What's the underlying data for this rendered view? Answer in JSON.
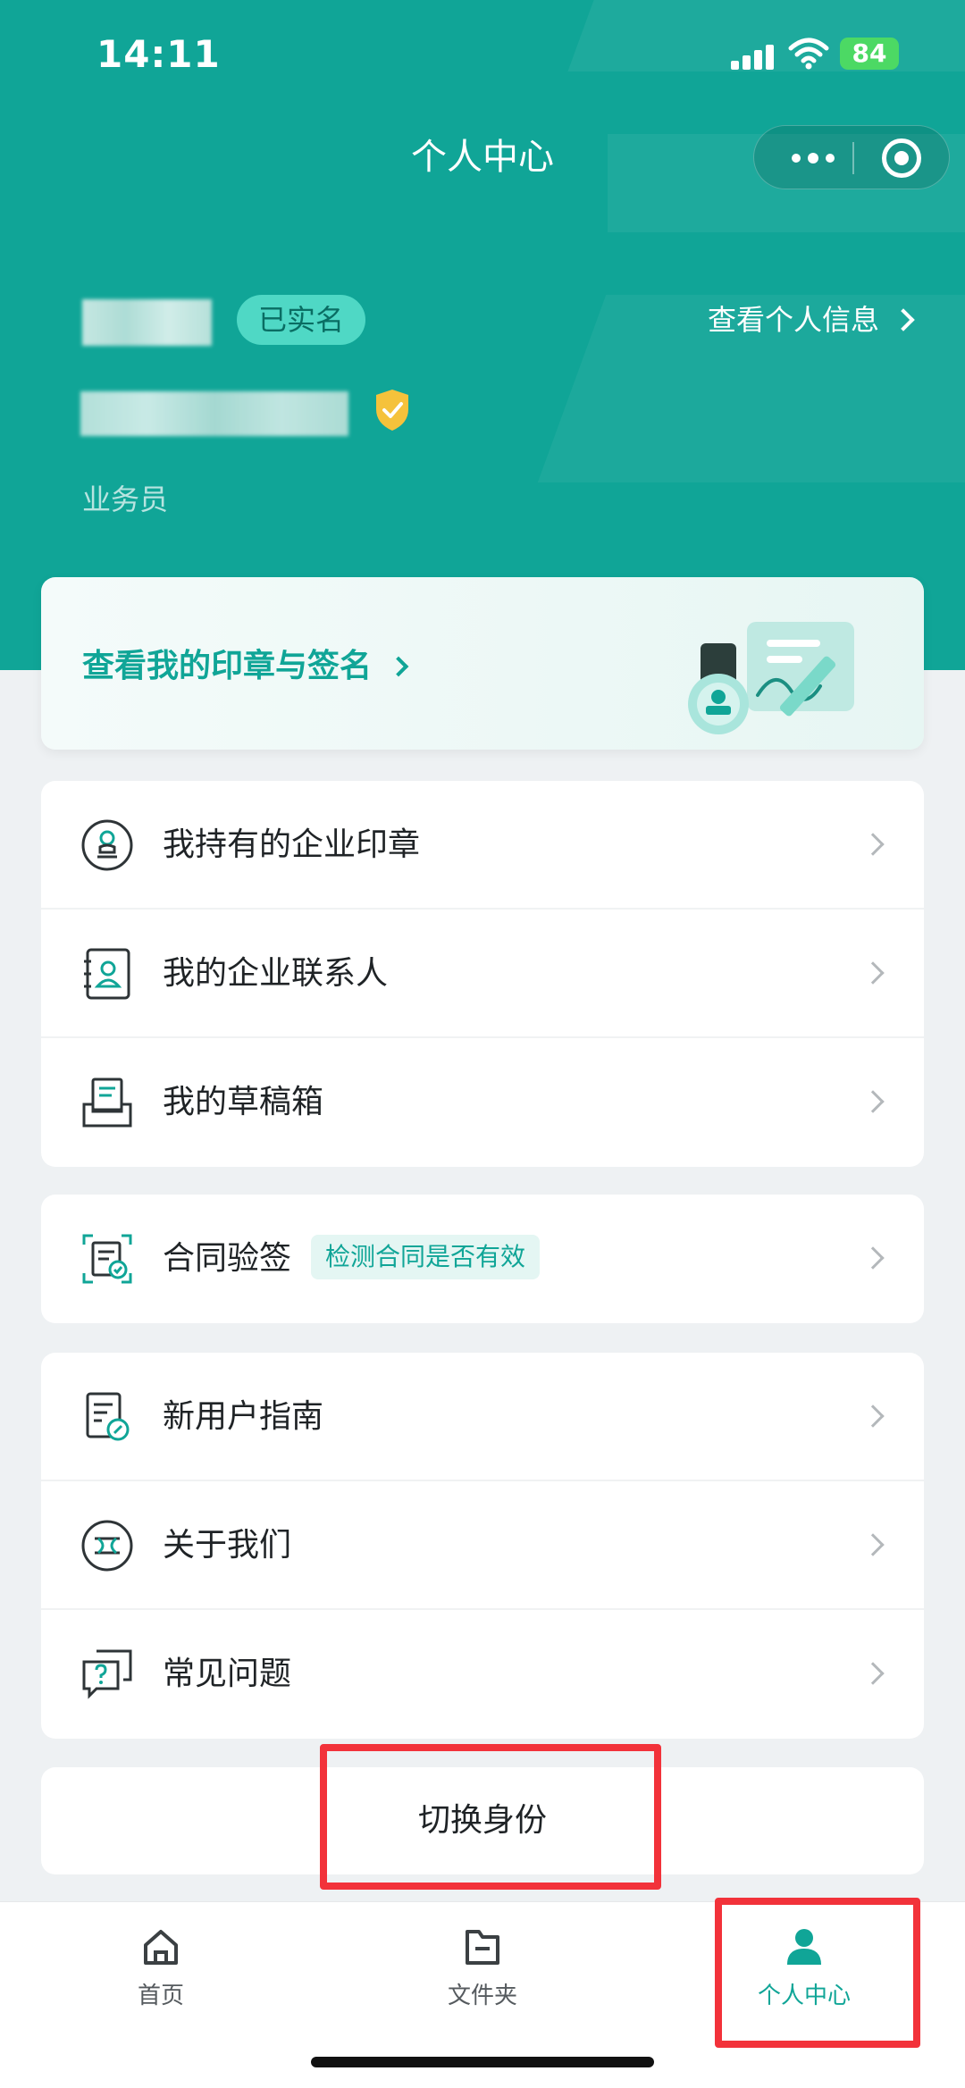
{
  "status_bar": {
    "time": "14:11",
    "battery": "84"
  },
  "nav": {
    "title": "个人中心"
  },
  "profile": {
    "verified_badge": "已实名",
    "view_info": "查看个人信息",
    "role": "业务员"
  },
  "seal_card": {
    "label": "查看我的印章与签名"
  },
  "menu_group_1": [
    {
      "label": "我持有的企业印章",
      "icon": "seal-icon"
    },
    {
      "label": "我的企业联系人",
      "icon": "contacts-icon"
    },
    {
      "label": "我的草稿箱",
      "icon": "drafts-icon"
    }
  ],
  "menu_group_2": [
    {
      "label": "合同验签",
      "tag": "检测合同是否有效",
      "icon": "verify-contract-icon"
    }
  ],
  "menu_group_3": [
    {
      "label": "新用户指南",
      "icon": "guide-icon"
    },
    {
      "label": "关于我们",
      "icon": "about-icon"
    },
    {
      "label": "常见问题",
      "icon": "faq-icon"
    }
  ],
  "switch_identity": {
    "label": "切换身份"
  },
  "tabbar": [
    {
      "label": "首页",
      "icon": "home-icon",
      "active": false
    },
    {
      "label": "文件夹",
      "icon": "folder-icon",
      "active": false
    },
    {
      "label": "个人中心",
      "icon": "person-icon",
      "active": true
    }
  ],
  "colors": {
    "brand": "#10a597",
    "highlight": "#f2323a",
    "badge": "#4fd8c5"
  }
}
